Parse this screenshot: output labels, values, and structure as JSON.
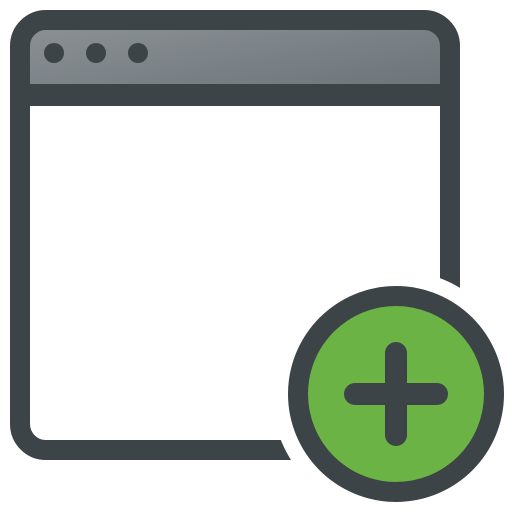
{
  "icon": {
    "name": "new-window-icon",
    "window": {
      "title_bar_dots": 3
    },
    "badge": {
      "symbol": "plus"
    }
  },
  "colors": {
    "outline": "#3c4447",
    "title_bar_top": "#8a9094",
    "title_bar_bottom": "#6e757a",
    "window_body": "#ffffff",
    "badge_fill": "#6ab344",
    "badge_outline": "#3c4447",
    "dots": "#3c4447"
  }
}
